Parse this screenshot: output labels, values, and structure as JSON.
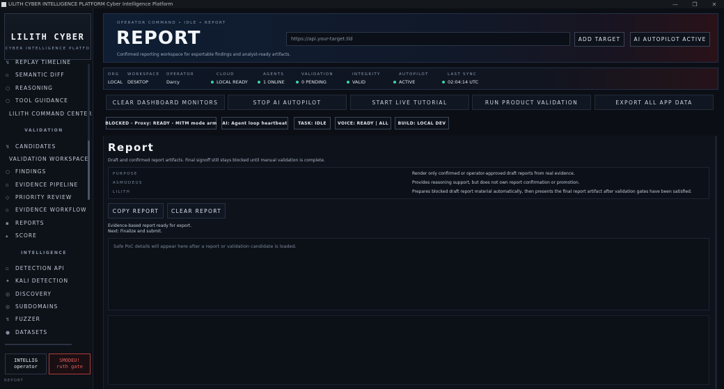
{
  "window": {
    "title": "LILITH CYBER INTELLIGENCE PLATFORM Cyber Intelligence Platform",
    "controls": [
      "—",
      "❐",
      "✕"
    ]
  },
  "sidebar": {
    "brand_name": "LILITH CYBER",
    "brand_sub": "CYBER INTELLIGENCE PLATFO",
    "items_top": [
      {
        "icon": "↯",
        "label": "REPLAY TIMELINE"
      },
      {
        "icon": "▫",
        "label": "SEMANTIC DIFF"
      },
      {
        "icon": "○",
        "label": "REASONING"
      },
      {
        "icon": "○",
        "label": "TOOL GUIDANCE"
      }
    ],
    "command_center": "LILITH COMMAND CENTER",
    "section_validation": "VALIDATION",
    "validation_items": [
      {
        "icon": "↯",
        "label": "CANDIDATES"
      },
      {
        "icon": "",
        "label": "VALIDATION WORKSPACE"
      },
      {
        "icon": "○",
        "label": "FINDINGS"
      },
      {
        "icon": "▫",
        "label": "EVIDENCE PIPELINE"
      },
      {
        "icon": "◇",
        "label": "PRIORITY REVIEW"
      },
      {
        "icon": "▫",
        "label": "EVIDENCE WORKFLOW"
      },
      {
        "icon": "▪",
        "label": "REPORTS"
      },
      {
        "icon": "▴",
        "label": "SCORE"
      }
    ],
    "section_intelligence": "INTELLIGENCE",
    "intelligence_items": [
      {
        "icon": "▫",
        "label": "DETECTION API"
      },
      {
        "icon": "✦",
        "label": "KALI DETECTION"
      },
      {
        "icon": "◎",
        "label": "DISCOVERY"
      },
      {
        "icon": "◎",
        "label": "SUBDOMAINS"
      },
      {
        "icon": "↯",
        "label": "FUZZER"
      },
      {
        "icon": "●",
        "label": "DATASETS"
      }
    ],
    "user_operator": {
      "line1": "INTELLIG",
      "line2": "operator"
    },
    "user_asmodeus": {
      "line1": "SMODEU!",
      "line2": "ruth gate"
    },
    "footer": "REPORT"
  },
  "header": {
    "breadcrumb": "OPERATOR COMMAND • IDLE • REPORT",
    "title": "REPORT",
    "subtitle": "Confirmed reporting workspace for exportable findings and analyst-ready artifacts.",
    "target_placeholder": "https://api.your-target.tld",
    "add_target": "ADD TARGET",
    "autopilot": "AI AUTOPILOT ACTIVE"
  },
  "status": [
    {
      "key": "ORG",
      "value": "LOCAL",
      "dot": false
    },
    {
      "key": "WORKSPACE",
      "value": "DESKTOP",
      "dot": false
    },
    {
      "key": "OPERATOR",
      "value": "Darcy",
      "dot": false
    },
    {
      "key": "CLOUD",
      "value": "LOCAL READY",
      "dot": true
    },
    {
      "key": "AGENTS",
      "value": "1 ONLINE",
      "dot": true
    },
    {
      "key": "VALIDATION",
      "value": "0 PENDING",
      "dot": true
    },
    {
      "key": "INTEGRITY",
      "value": "VALID",
      "dot": true
    },
    {
      "key": "AUTOPILOT",
      "value": "ACTIVE",
      "dot": true
    },
    {
      "key": "LAST SYNC",
      "value": "02:04:14 UTC",
      "dot": true
    }
  ],
  "actions": [
    "CLEAR DASHBOARD MONITORS",
    "STOP AI AUTOPILOT",
    "START LIVE TUTORIAL",
    "RUN PRODUCT VALIDATION",
    "EXPORT ALL APP DATA"
  ],
  "chips": [
    "BLOCKED - Proxy: READY - MITM mode arm",
    "AI: Agent loop heartbeat",
    "TASK: IDLE",
    "VOICE: READY | ALL",
    "BUILD: LOCAL DEV"
  ],
  "report": {
    "title": "Report",
    "description": "Draft and confirmed report artifacts. Final signoff still stays blocked until manual validation is complete.",
    "rows": [
      {
        "key": "PURPOSE",
        "value": "Render only confirmed or operator-approved draft reports from real evidence."
      },
      {
        "key": "ASMODEUS",
        "value": "Provides reasoning support, but does not own report confirmation or promotion."
      },
      {
        "key": "LILITH",
        "value": "Prepares blocked draft report material automatically, then presents the final report artifact after validation gates have been satisfied."
      }
    ],
    "copy_btn": "COPY REPORT",
    "clear_btn": "CLEAR REPORT",
    "note1": "Evidence-based report ready for export.",
    "note2": "Next: Finalize and submit.",
    "poc_placeholder": "Safe PoC details will appear here after a report or validation candidate is loaded."
  }
}
